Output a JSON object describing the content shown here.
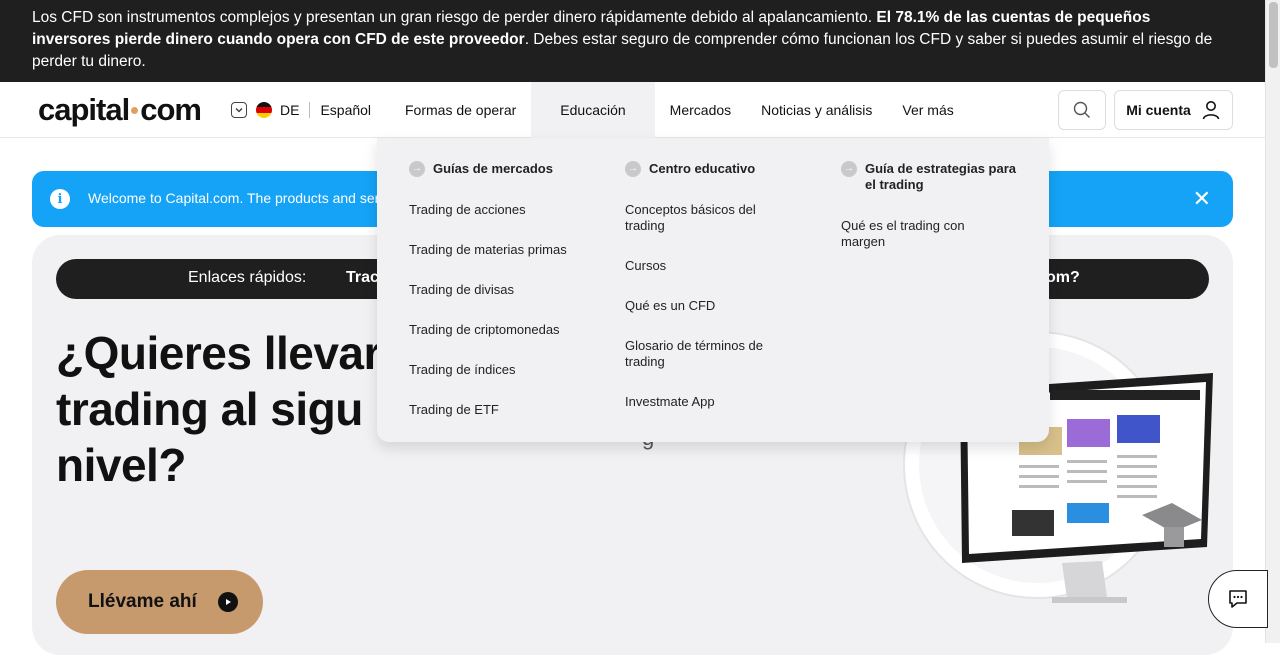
{
  "risk_banner": {
    "text_before": "Los CFD son instrumentos complejos y presentan un gran riesgo de perder dinero rápidamente debido al apalancamiento. ",
    "text_bold": "El 78.1% de las cuentas de pequeños inversores pierde dinero cuando opera con CFD de este proveedor",
    "text_after": ". Debes estar seguro de comprender cómo funcionan los CFD y saber si puedes asumir el riesgo de perder tu dinero."
  },
  "header": {
    "logo_left": "capital",
    "logo_right": "com",
    "region_code": "DE",
    "language": "Español",
    "nav": [
      "Formas de operar",
      "Educación",
      "Mercados",
      "Noticias y análisis",
      "Ver más"
    ],
    "active_nav": "Educación",
    "account_label": "Mi cuenta"
  },
  "welcome": {
    "text": "Welcome to Capital.com. The products and servi"
  },
  "hero": {
    "quick_links_label": "Enlaces rápidos:",
    "quick_link_1": "Trac",
    "quick_link_2": "om?",
    "title_line1": "¿Quieres llevar",
    "title_line2": "trading al sigu",
    "title_line3": "nivel?",
    "subtitle_fragment": "g",
    "cta_label": "Llévame ahí"
  },
  "dropdown": {
    "columns": [
      {
        "heading": "Guías de mercados",
        "links": [
          "Trading de acciones",
          "Trading de materias primas",
          "Trading de divisas",
          "Trading de criptomonedas",
          "Trading de índices",
          "Trading de ETF"
        ]
      },
      {
        "heading": "Centro educativo",
        "links": [
          "Conceptos básicos del trading",
          "Cursos",
          "Qué es un CFD",
          "Glosario de términos de trading",
          "Investmate App"
        ]
      },
      {
        "heading": "Guía de estrategias para el trading",
        "links": [
          "Qué es el trading con margen"
        ]
      }
    ]
  },
  "colors": {
    "banner_bg": "#1f1f1f",
    "welcome_bg": "#14a3f6",
    "cta_bg": "#c79a6e",
    "hero_bg": "#f1f1f3",
    "logo_dot": "#e0a064"
  },
  "icons": [
    "chevron-down-icon",
    "flag-de-icon",
    "search-icon",
    "user-icon",
    "info-icon",
    "close-icon",
    "play-icon",
    "arrow-right-icon",
    "chat-icon"
  ]
}
